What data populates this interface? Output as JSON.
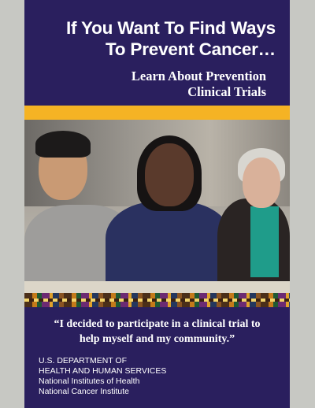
{
  "cover": {
    "headline_line1": "If You Want To Find Ways",
    "headline_line2": "To Prevent Cancer…",
    "subhead_line1": "Learn About Prevention",
    "subhead_line2": "Clinical Trials",
    "quote_line1": "“I decided to participate in a clinical trial to",
    "quote_line2": "help myself and my community.”",
    "agency": [
      "U.S. DEPARTMENT OF",
      "HEALTH AND HUMAN SERVICES",
      "National Institutes of Health",
      "National Cancer Institute"
    ]
  },
  "colors": {
    "cover_background": "#2a1f5e",
    "accent_bar": "#f5b324",
    "page_background": "#c7c8c3"
  }
}
